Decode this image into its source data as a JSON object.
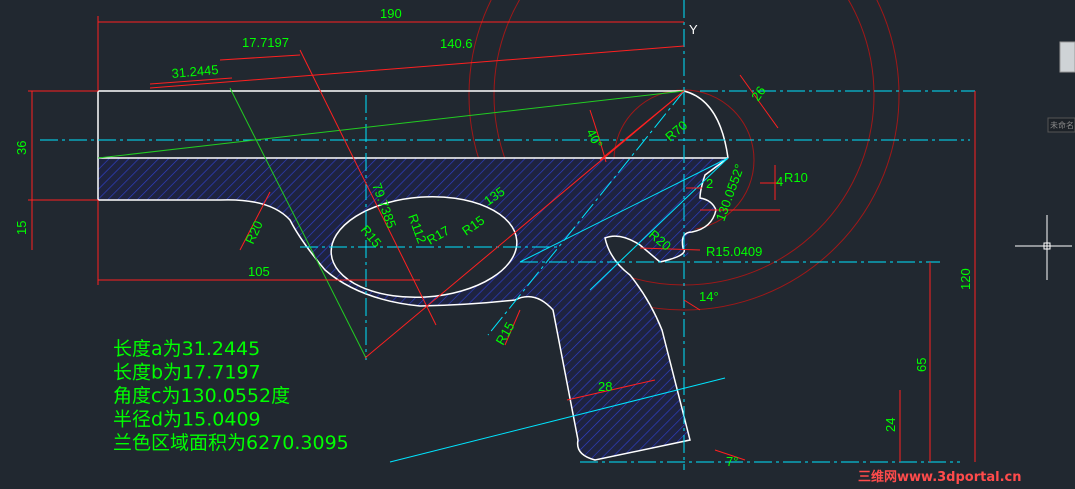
{
  "drawing": {
    "y_axis_label": "Y",
    "dimensions": [
      {
        "id": "dim-190",
        "text": "190"
      },
      {
        "id": "dim-140-6",
        "text": "140.6"
      },
      {
        "id": "dim-17-7197",
        "text": "17.7197"
      },
      {
        "id": "dim-31-2445",
        "text": "31.2445"
      },
      {
        "id": "dim-40deg",
        "text": "40°"
      },
      {
        "id": "dim-r70",
        "text": "R70"
      },
      {
        "id": "dim-26",
        "text": "26"
      },
      {
        "id": "dim-36",
        "text": "36"
      },
      {
        "id": "dim-15",
        "text": "15"
      },
      {
        "id": "dim-r20-left",
        "text": "R20"
      },
      {
        "id": "dim-105",
        "text": "105"
      },
      {
        "id": "dim-r15-slot",
        "text": "R15"
      },
      {
        "id": "dim-79-7385",
        "text": "79.7385"
      },
      {
        "id": "dim-r112",
        "text": "R112"
      },
      {
        "id": "dim-r17",
        "text": "R17"
      },
      {
        "id": "dim-r15-mid",
        "text": "R15"
      },
      {
        "id": "dim-135",
        "text": "135"
      },
      {
        "id": "dim-2",
        "text": "2"
      },
      {
        "id": "dim-130-0552",
        "text": "130.0552°"
      },
      {
        "id": "dim-4",
        "text": "4"
      },
      {
        "id": "dim-r10",
        "text": "R10"
      },
      {
        "id": "dim-r20-right",
        "text": "R20"
      },
      {
        "id": "dim-r15-0409",
        "text": "R15.0409"
      },
      {
        "id": "dim-14deg",
        "text": "14°"
      },
      {
        "id": "dim-r15-lower",
        "text": "R15"
      },
      {
        "id": "dim-28",
        "text": "28"
      },
      {
        "id": "dim-120",
        "text": "120"
      },
      {
        "id": "dim-65",
        "text": "65"
      },
      {
        "id": "dim-24",
        "text": "24"
      },
      {
        "id": "dim-7deg",
        "text": "7°"
      }
    ],
    "notes": [
      "长度a为31.2445",
      "长度b为17.7197",
      "角度c为130.0552度",
      "半径d为15.0409",
      "兰色区域面积为6270.3095"
    ],
    "watermark": "三维网www.3dportal.cn",
    "side_panel_label": "未命名",
    "colors": {
      "background": "#212830",
      "outline": "#ffffff",
      "dimension_red": "#ff2020",
      "dimension_text": "#00ff00",
      "centerline_cyan": "#00e5ff",
      "construction_dark_red": "#a01818",
      "hatch_blue": "#2f3fc8",
      "construction_green": "#22cc22"
    }
  }
}
